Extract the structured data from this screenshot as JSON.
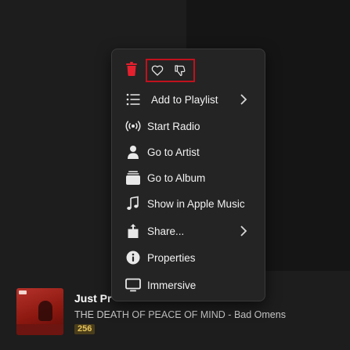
{
  "colors": {
    "accent_red": "#e5202e",
    "highlight_border": "#c0111d",
    "menu_bg": "#242424",
    "quality_badge": "#e5c45a"
  },
  "menu": {
    "delete_icon": "trash-icon",
    "rating": {
      "love_icon": "heart-icon",
      "dislike_icon": "thumbs-down-icon"
    },
    "items": [
      {
        "label": "Add to Playlist",
        "icon": "list-icon",
        "submenu": true
      },
      {
        "label": "Start Radio",
        "icon": "radio-waves-icon",
        "submenu": false
      },
      {
        "label": "Go to Artist",
        "icon": "person-icon",
        "submenu": false
      },
      {
        "label": "Go to Album",
        "icon": "album-stack-icon",
        "submenu": false
      },
      {
        "label": "Show in Apple Music",
        "icon": "music-note-icon",
        "submenu": false
      },
      {
        "label": "Share...",
        "icon": "share-icon",
        "submenu": true
      },
      {
        "label": "Properties",
        "icon": "info-icon",
        "submenu": false
      },
      {
        "label": "Immersive",
        "icon": "monitor-icon",
        "submenu": false
      }
    ]
  },
  "now_playing": {
    "title": "Just Pr",
    "subtitle": "THE DEATH OF PEACE OF MIND - Bad Omens",
    "quality": "256"
  }
}
